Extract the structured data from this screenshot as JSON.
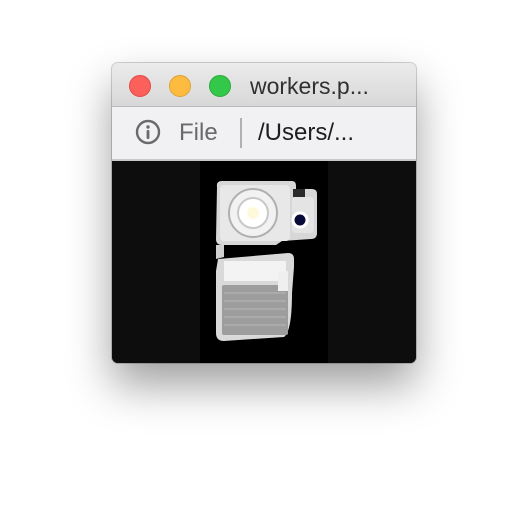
{
  "window": {
    "title": "workers.p...",
    "traffic_lights": {
      "close_color": "#fc605b",
      "minimize_color": "#fdbc40",
      "maximize_color": "#34c84a"
    }
  },
  "toolbar": {
    "info_icon": "info-circle-icon",
    "file_label": "File",
    "path_label": "/Users/..."
  },
  "content": {
    "image_description_icon": "camera-module-photo"
  }
}
